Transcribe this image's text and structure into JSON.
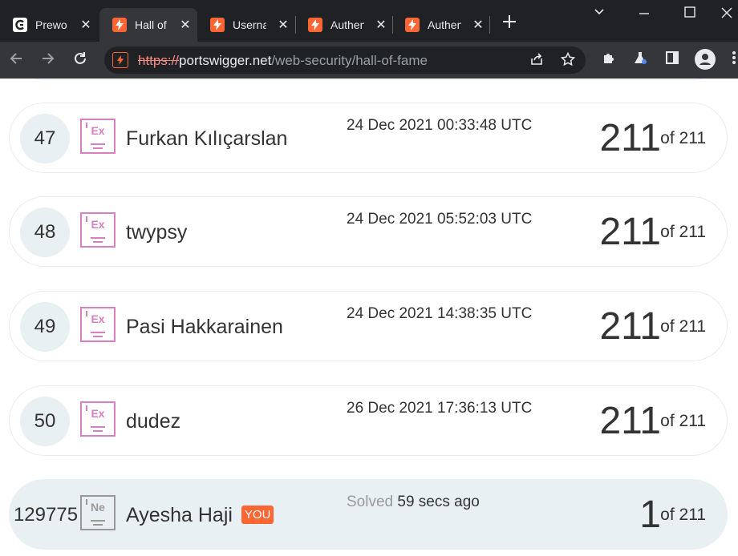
{
  "browser": {
    "tabs": [
      {
        "title": "Prewo",
        "close": "✕",
        "active": false,
        "favicon": "cg"
      },
      {
        "title": "Hall of",
        "close": "✕",
        "active": true,
        "favicon": "ps"
      },
      {
        "title": "Userna",
        "close": "✕",
        "active": false,
        "favicon": "ps"
      },
      {
        "title": "Authen",
        "close": "✕",
        "active": false,
        "favicon": "ps"
      },
      {
        "title": "Authen",
        "close": "✕",
        "active": false,
        "favicon": "ps"
      }
    ],
    "url_scheme": "https://",
    "url_host": "portswigger.net",
    "url_path": "/web-security/hall-of-fame"
  },
  "entries": [
    {
      "rank": "47",
      "badge": "Ex",
      "name": "Furkan Kılıçarslan",
      "date": "24 Dec 2021 00:33:48 UTC",
      "score": "211",
      "of_total": "of 211"
    },
    {
      "rank": "48",
      "badge": "Ex",
      "name": "twypsy",
      "date": "24 Dec 2021 05:52:03 UTC",
      "score": "211",
      "of_total": "of 211"
    },
    {
      "rank": "49",
      "badge": "Ex",
      "name": "Pasi Hakkarainen",
      "date": "24 Dec 2021 14:38:35 UTC",
      "score": "211",
      "of_total": "of 211"
    },
    {
      "rank": "50",
      "badge": "Ex",
      "name": "dudez",
      "date": "26 Dec 2021 17:36:13 UTC",
      "score": "211",
      "of_total": "of 211"
    }
  ],
  "current_user": {
    "rank": "129775",
    "badge": "Ne",
    "name": "Ayesha Haji",
    "you_label": "YOU",
    "solved_label": "Solved",
    "solved_time": "59 secs ago",
    "score": "1",
    "of_total": "of 211"
  },
  "colors": {
    "accent": "#ff6633",
    "badge_expert": "#d97ec0",
    "badge_novice": "#999999",
    "row_bg": "#e9f0f4"
  }
}
